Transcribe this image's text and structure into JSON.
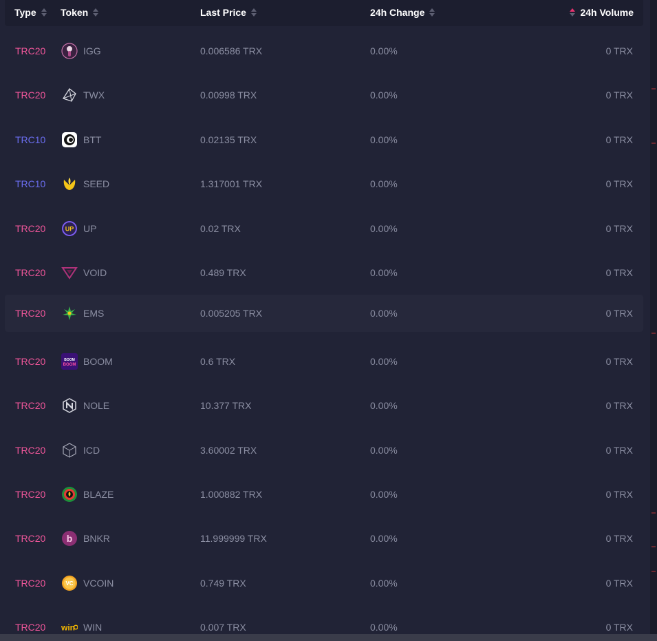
{
  "header": {
    "type_label": "Type",
    "token_label": "Token",
    "price_label": "Last Price",
    "change_label": "24h Change",
    "volume_label": "24h Volume"
  },
  "colors": {
    "trc20": "#f0569a",
    "trc10": "#6b6ef0",
    "active_sort": "#e8326f"
  },
  "rows": [
    {
      "type": "TRC20",
      "token": "IGG",
      "price": "0.006586 TRX",
      "change": "0.00%",
      "volume": "0 TRX",
      "icon": "igg-icon"
    },
    {
      "type": "TRC20",
      "token": "TWX",
      "price": "0.00998 TRX",
      "change": "0.00%",
      "volume": "0 TRX",
      "icon": "twx-icon"
    },
    {
      "type": "TRC10",
      "token": "BTT",
      "price": "0.02135 TRX",
      "change": "0.00%",
      "volume": "0 TRX",
      "icon": "btt-icon"
    },
    {
      "type": "TRC10",
      "token": "SEED",
      "price": "1.317001 TRX",
      "change": "0.00%",
      "volume": "0 TRX",
      "icon": "seed-icon"
    },
    {
      "type": "TRC20",
      "token": "UP",
      "price": "0.02 TRX",
      "change": "0.00%",
      "volume": "0 TRX",
      "icon": "up-icon"
    },
    {
      "type": "TRC20",
      "token": "VOID",
      "price": "0.489 TRX",
      "change": "0.00%",
      "volume": "0 TRX",
      "icon": "void-icon"
    },
    {
      "type": "TRC20",
      "token": "EMS",
      "price": "0.005205 TRX",
      "change": "0.00%",
      "volume": "0 TRX",
      "icon": "ems-icon"
    },
    {
      "type": "TRC20",
      "token": "BOOM",
      "price": "0.6 TRX",
      "change": "0.00%",
      "volume": "0 TRX",
      "icon": "boom-icon"
    },
    {
      "type": "TRC20",
      "token": "NOLE",
      "price": "10.377 TRX",
      "change": "0.00%",
      "volume": "0 TRX",
      "icon": "nole-icon"
    },
    {
      "type": "TRC20",
      "token": "ICD",
      "price": "3.60002 TRX",
      "change": "0.00%",
      "volume": "0 TRX",
      "icon": "icd-icon"
    },
    {
      "type": "TRC20",
      "token": "BLAZE",
      "price": "1.000882 TRX",
      "change": "0.00%",
      "volume": "0 TRX",
      "icon": "blaze-icon"
    },
    {
      "type": "TRC20",
      "token": "BNKR",
      "price": "11.999999 TRX",
      "change": "0.00%",
      "volume": "0 TRX",
      "icon": "bnkr-icon"
    },
    {
      "type": "TRC20",
      "token": "VCOIN",
      "price": "0.749 TRX",
      "change": "0.00%",
      "volume": "0 TRX",
      "icon": "vcoin-icon"
    },
    {
      "type": "TRC20",
      "token": "WIN",
      "price": "0.007 TRX",
      "change": "0.00%",
      "volume": "0 TRX",
      "icon": "win-icon"
    }
  ],
  "icon_labels": {
    "up": "UP",
    "boom": "BOOM",
    "vcoin": "VC",
    "win": "win"
  }
}
